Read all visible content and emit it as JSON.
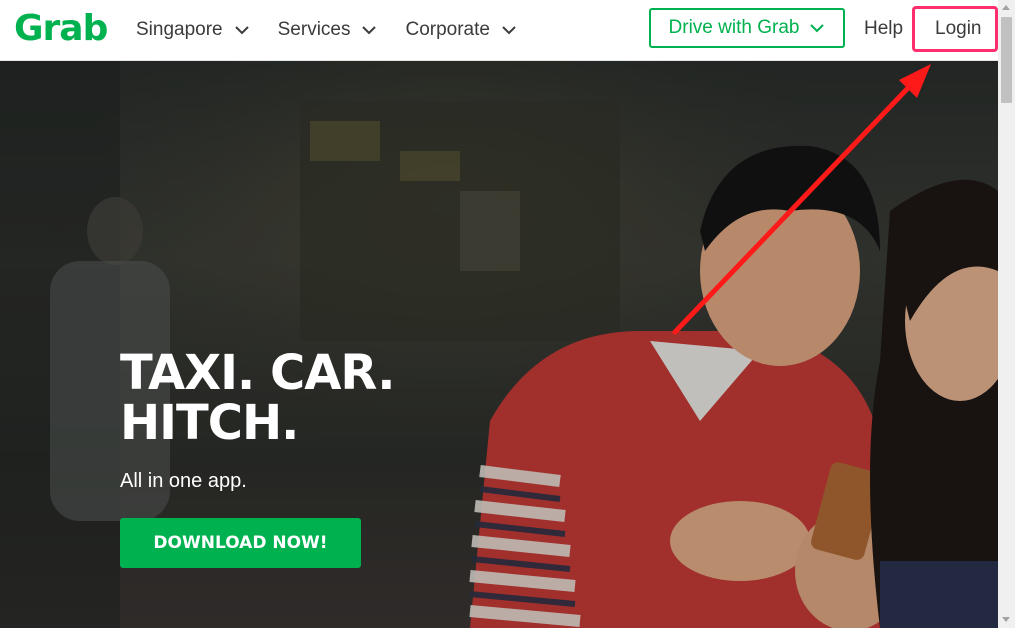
{
  "header": {
    "logo_text": "Grab",
    "nav": [
      {
        "label": "Singapore"
      },
      {
        "label": "Services"
      },
      {
        "label": "Corporate"
      }
    ],
    "drive_label": "Drive with Grab",
    "help_label": "Help",
    "login_label": "Login"
  },
  "hero": {
    "headline_line1": "TAXI. CAR.",
    "headline_line2": "HITCH.",
    "subline": "All in one app.",
    "cta_label": "DOWNLOAD NOW!"
  },
  "colors": {
    "brand_green": "#00b14f",
    "highlight": "#ff2f6d",
    "arrow": "#ff1a1a"
  },
  "icons": [
    "chevron-down-icon",
    "grab-logo",
    "red-arrow-annotation"
  ]
}
